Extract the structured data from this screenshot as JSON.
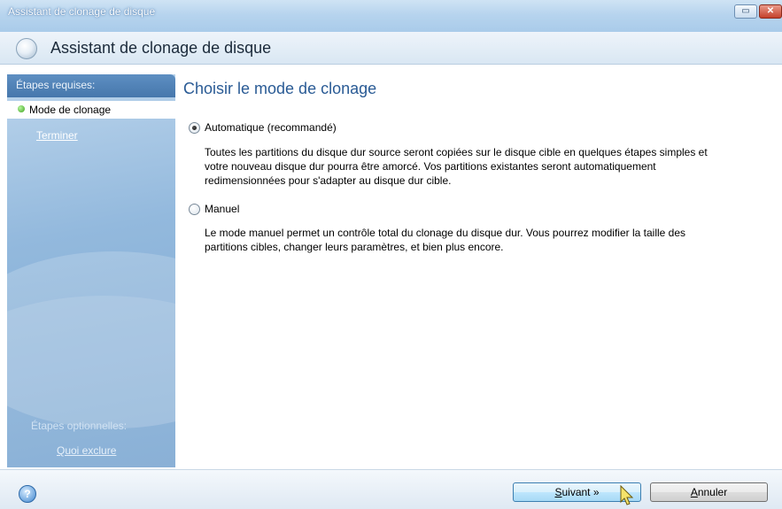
{
  "window": {
    "title": "Assistant de clonage de disque",
    "header_title": "Assistant de clonage de disque",
    "min_label": "▭",
    "close_label": "✕"
  },
  "sidebar": {
    "required_header": "Étapes requises:",
    "steps": [
      {
        "label": "Mode de clonage",
        "state": "current"
      },
      {
        "label": "Terminer",
        "state": "link"
      }
    ],
    "optional_header": "Étapes optionnelles:",
    "optional_link": "Quoi exclure"
  },
  "main": {
    "title": "Choisir le mode de clonage",
    "options": [
      {
        "label": "Automatique (recommandé)",
        "checked": true,
        "description_lines": [
          "Toutes les partitions du disque dur source seront copiées sur le disque cible en quelques étapes simples et",
          "votre nouveau disque dur pourra être amorcé. Vos partitions existantes seront automatiquement",
          "redimensionnées pour s'adapter au disque dur cible."
        ]
      },
      {
        "label": "Manuel",
        "checked": false,
        "description_lines": [
          "Le mode manuel permet un contrôle total du clonage du disque dur. Vous pourrez modifier la taille des",
          "partitions cibles, changer leurs paramètres, et bien plus encore."
        ]
      }
    ]
  },
  "footer": {
    "next_mnemonic": "S",
    "next_rest": "uivant »",
    "cancel_mnemonic": "A",
    "cancel_rest": "nnuler",
    "help_icon": "?"
  },
  "colors": {
    "title_accent": "#2a5b95",
    "sidebar_blue": "#93b9dd",
    "step_dot": "#3da21f"
  }
}
